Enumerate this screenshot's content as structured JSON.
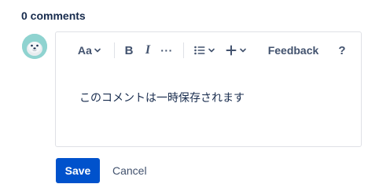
{
  "comments": {
    "heading": "0 comments"
  },
  "toolbar": {
    "text_style_label": "Aa",
    "bold_label": "B",
    "italic_label": "I",
    "more_label": "···",
    "feedback_label": "Feedback",
    "help_label": "?"
  },
  "editor": {
    "content": "このコメントは一時保存されます"
  },
  "actions": {
    "save_label": "Save",
    "cancel_label": "Cancel"
  },
  "colors": {
    "primary": "#0052cc",
    "text": "#172b4d",
    "icon": "#42526e",
    "border": "#dfe1e6",
    "avatar_bg": "#8fd3d0"
  },
  "icons": {
    "avatar": "seal-avatar-icon",
    "text_style_chevron": "chevron-down-icon",
    "bullet_list": "bullet-list-icon",
    "insert": "plus-icon"
  }
}
